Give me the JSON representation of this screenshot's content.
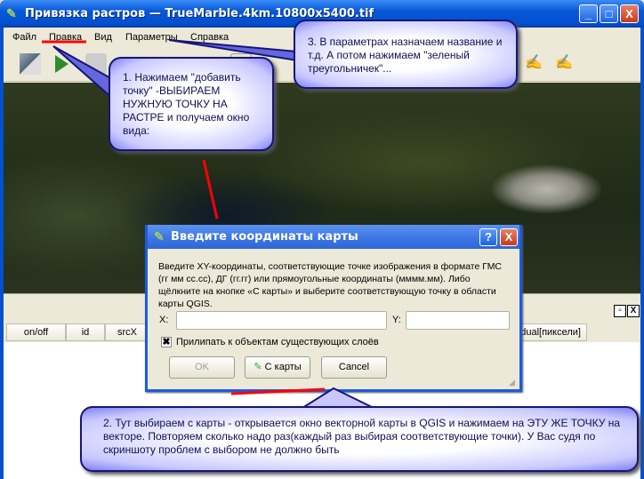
{
  "window": {
    "title": "Привязка растров — TrueMarble.4km.10800x5400.tif",
    "minimize": "_",
    "maximize": "□",
    "close": "X"
  },
  "menu": [
    "Файл",
    "Правка",
    "Вид",
    "Параметры",
    "Справка"
  ],
  "toolbar_icons": [
    "add-raster-icon",
    "start-georeferencing-icon",
    "generate-script-icon",
    "select-point-icon",
    "delete-point-icon",
    "move-point-icon",
    "pan-icon",
    "zoom-icon"
  ],
  "dock": {
    "restore": "▫",
    "close": "X"
  },
  "table": {
    "headers": [
      "on/off",
      "id",
      "srcX",
      "residual[пиксели]"
    ]
  },
  "dialog": {
    "title": "Введите координаты карты",
    "help": "?",
    "close": "X",
    "description": "Введите XY-координаты, соответствующие точке изображения в формате ГМС (гг мм сс.сс), ДГ (гг.гг) или прямоугольные координаты (мммм.мм). Либо щёлкните на кнопке «С карты» и выберите соответствующую точку в области карты QGIS.",
    "x_label": "X:",
    "x_value": "",
    "y_label": "Y:",
    "y_value": "",
    "snap_label": "Прилипать к объектам существующих слоёв",
    "snap_checked": true,
    "ok": "OK",
    "from_map": "С карты",
    "cancel": "Cancel"
  },
  "callouts": {
    "c1": "1. Нажимаем \"добавить точку\" -ВЫБИРАЕМ НУЖНУЮ ТОЧКУ НА РАСТРЕ и получаем окно  вида:",
    "c2": "2. Тут выбираем с карты - открывается окно векторной карты в QGIS и нажимаем на ЭТУ ЖЕ ТОЧКУ на векторе. Повторяем сколько надо раз(каждый раз выбирая соответствующие точки). У Вас судя по скриншоту проблем с выбором не должно быть",
    "c3": "3. В параметрах назначаем название и т.д.  А потом нажимаем \"зеленый треугольничек\"..."
  },
  "colors": {
    "accent": "#0450cf",
    "annotation_red": "#ff0000",
    "callout_border": "#15157a"
  }
}
